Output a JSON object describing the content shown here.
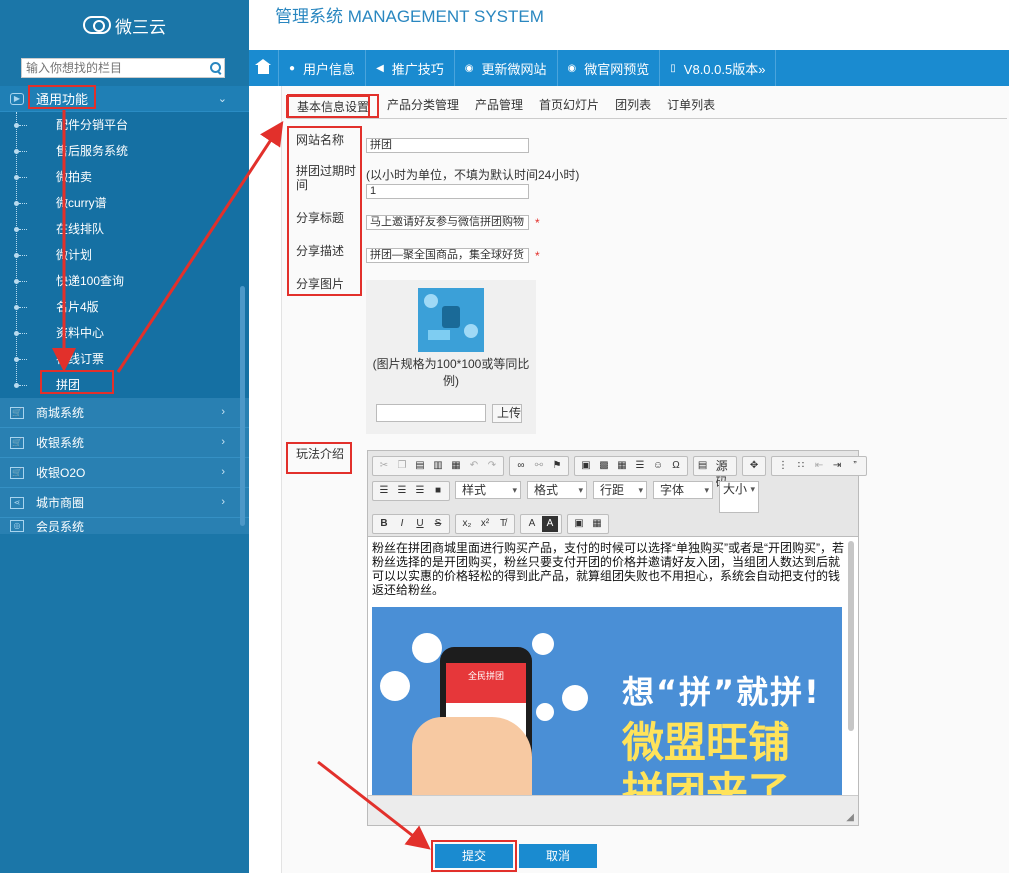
{
  "header": {
    "logo_text": "微三云",
    "system_title": "管理系统 MANAGEMENT SYSTEM"
  },
  "sidebar": {
    "search_placeholder": "输入你想找的栏目",
    "group_label": "通用功能",
    "sub_items": [
      "配件分销平台",
      "售后服务系统",
      "微拍卖",
      "微curry谱",
      "在线排队",
      "微计划",
      "快递100查询",
      "名片4版",
      "资料中心",
      "在线订票",
      "拼团"
    ],
    "categories": [
      "商城系统",
      "收银系统",
      "收银O2O",
      "城市商圈",
      "会员系统"
    ]
  },
  "navbar": {
    "items": [
      {
        "icon": "user-icon",
        "label": "用户信息"
      },
      {
        "icon": "megaphone-icon",
        "label": "推广技巧"
      },
      {
        "icon": "globe-icon",
        "label": "更新微网站"
      },
      {
        "icon": "eye-icon",
        "label": "微官网预览"
      },
      {
        "icon": "phone-icon",
        "label": "V8.0.0.5版本»"
      }
    ]
  },
  "tabs": [
    "基本信息设置",
    "产品分类管理",
    "产品管理",
    "首页幻灯片",
    "团列表",
    "订单列表"
  ],
  "form": {
    "site_name_label": "网站名称",
    "site_name_value": "拼团",
    "expire_label": "拼团过期时间",
    "expire_hint": "(以小时为单位，不填为默认时间24小时)",
    "expire_value": "1",
    "share_title_label": "分享标题",
    "share_title_value": "马上邀请好友参与微信拼团购物",
    "share_desc_label": "分享描述",
    "share_desc_value": "拼团—聚全国商品，集全球好货",
    "share_img_label": "分享图片",
    "img_hint": "(图片规格为100*100或等同比例)",
    "upload_label": "上传",
    "intro_label": "玩法介绍"
  },
  "editor": {
    "source_label": "源码",
    "drop_style": "样式",
    "drop_format": "格式",
    "drop_spacing": "行距",
    "drop_font": "字体",
    "drop_size": "大小",
    "content_text": "粉丝在拼团商城里面进行购买产品，支付的时候可以选择“单独购买”或者是“开团购买”，若粉丝选择的是开团购买，粉丝只要支付开团的价格并邀请好友入团，当组团人数达到后就可以以实惠的价格轻松的得到此产品，就算组团失败也不用担心，系统会自动把支付的钱返还给粉丝。",
    "banner_line1": "想“拼”就拼!",
    "banner_line2": "微盟旺铺",
    "banner_line3": "拼团来了",
    "banner_phone_head": "全民拼团"
  },
  "actions": {
    "submit_label": "提交",
    "cancel_label": "取消"
  },
  "colors": {
    "sidebar": "#1b76a8",
    "nav": "#1a8bd0",
    "annotation": "#e2302b"
  }
}
